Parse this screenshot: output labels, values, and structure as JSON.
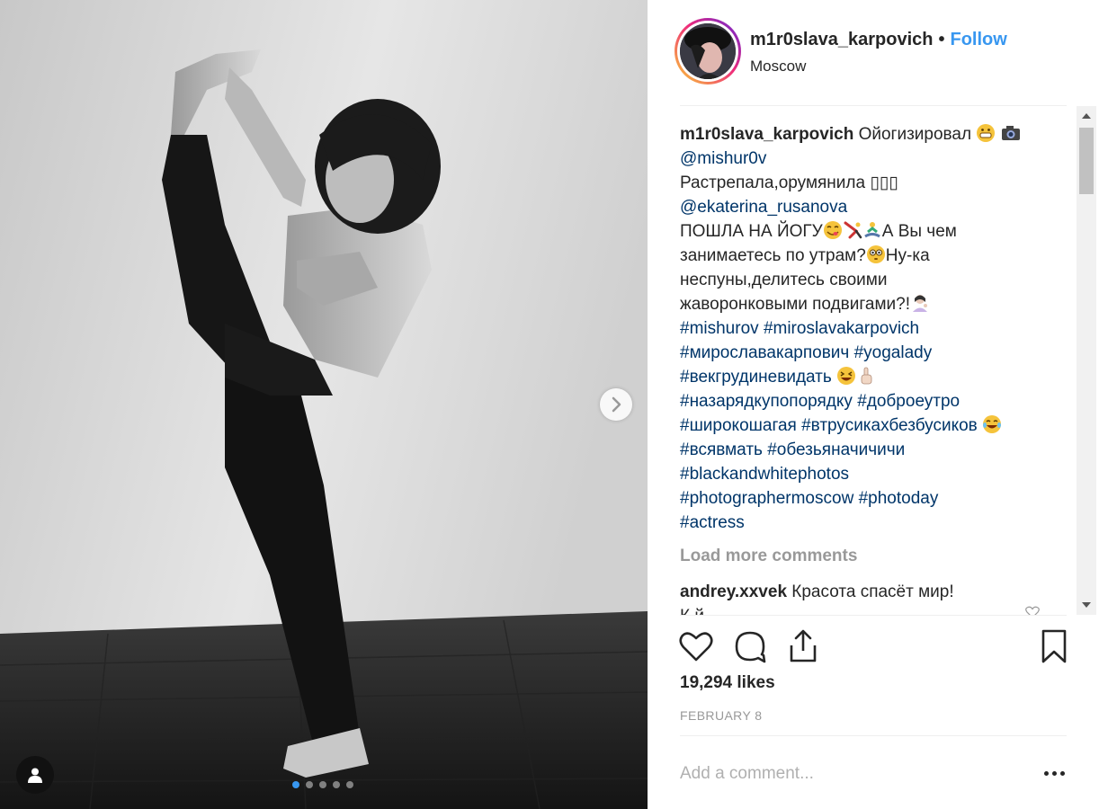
{
  "post": {
    "username": "m1r0slava_karpovich",
    "separator": "•",
    "follow_label": "Follow",
    "location": "Moscow"
  },
  "caption": {
    "username": "m1r0slava_karpovich",
    "line1_text": "Ойогизировал",
    "mention1": "@mishur0v",
    "line3_text": "Растрепала,орумянила",
    "line3_glyphs": "▯▯▯",
    "mention2": "@ekaterina_rusanova",
    "line5_a": "ПОШЛА НА ЙОГУ",
    "line5_b": "А Вы чем",
    "line6_a": "занимаетесь по утрам?",
    "line6_b": "Ну-ка",
    "line7": "неспуны,делитесь своими",
    "line8": "жаворонковыми подвигами?!",
    "tags": [
      "#mishurov",
      "#miroslavakarpovich",
      "#мирославакарпович",
      "#yogalady",
      "#векгрудиневидать",
      "#назарядкупопорядку",
      "#доброеутро",
      "#широкошагая",
      "#втрусикахбезбусиков",
      "#всявмать",
      "#обезьяначичичи",
      "#blackandwhitephotos",
      "#photographermoscow",
      "#photoday",
      "#actress"
    ]
  },
  "load_more_label": "Load more comments",
  "comment2": {
    "username": "andrey.xxvek",
    "text": "Красота спасёт мир!",
    "next_line_partial": "К  й"
  },
  "stats": {
    "likes": "19,294 likes",
    "date": "FEBRUARY 8"
  },
  "composer": {
    "placeholder": "Add a comment..."
  },
  "carousel": {
    "total_slides": 5,
    "active_slide": 1
  },
  "colors": {
    "link": "#003569",
    "follow": "#3897f0",
    "muted": "#999999",
    "text": "#262626"
  },
  "icons": [
    "chevron-right-icon",
    "user-tag-icon",
    "heart-icon",
    "comment-icon",
    "share-icon",
    "bookmark-icon",
    "more-icon"
  ]
}
